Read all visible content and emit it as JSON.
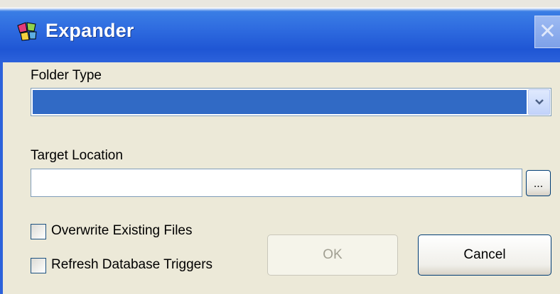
{
  "window": {
    "title": "Expander",
    "icon": "expander-app-icon",
    "close_glyph": "✕"
  },
  "form": {
    "folder_type_label": "Folder Type",
    "folder_type_value": "",
    "target_location_label": "Target Location",
    "target_location_value": "",
    "browse_label": "...",
    "overwrite_label": "Overwrite Existing Files",
    "overwrite_checked": false,
    "refresh_label": "Refresh Database Triggers",
    "refresh_checked": false
  },
  "buttons": {
    "ok_label": "OK",
    "ok_enabled": false,
    "cancel_label": "Cancel"
  },
  "colors": {
    "titlebar": "#2c62db",
    "selection": "#316ac5",
    "dialog_bg": "#ece9d8"
  }
}
